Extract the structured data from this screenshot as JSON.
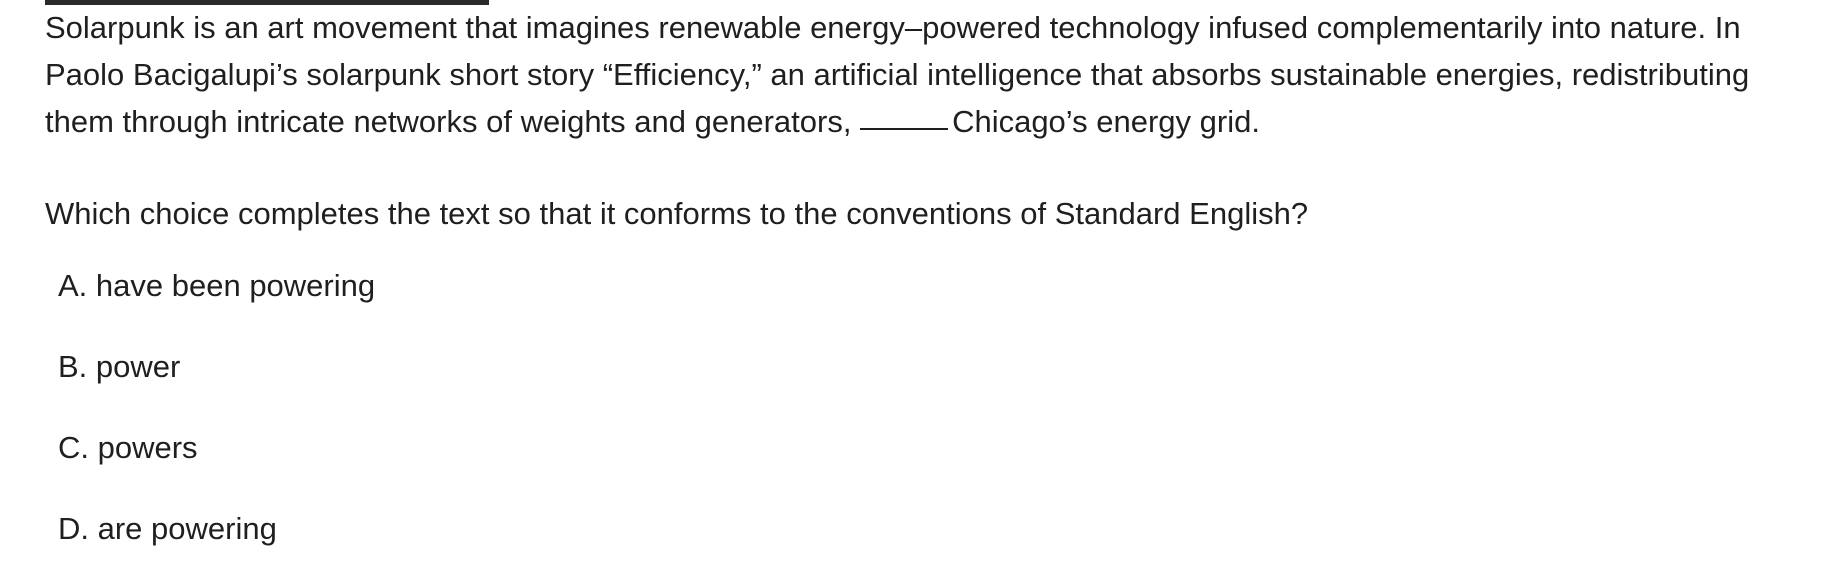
{
  "passage": {
    "text_before_blank": "Solarpunk is an art movement that imagines renewable energy–powered technology infused complementarily into nature. In Paolo Bacigalupi’s solarpunk short story “Efficiency,” an artificial intelligence that absorbs sustainable energies, redistributing them through intricate networks of weights and generators, ",
    "text_after_blank": "Chicago’s energy grid."
  },
  "question": {
    "prompt": "Which choice completes the text so that it conforms to the conventions of Standard English?"
  },
  "choices": [
    {
      "label": "A. have been powering"
    },
    {
      "label": "B. power"
    },
    {
      "label": "C. powers"
    },
    {
      "label": "D. are powering"
    }
  ]
}
